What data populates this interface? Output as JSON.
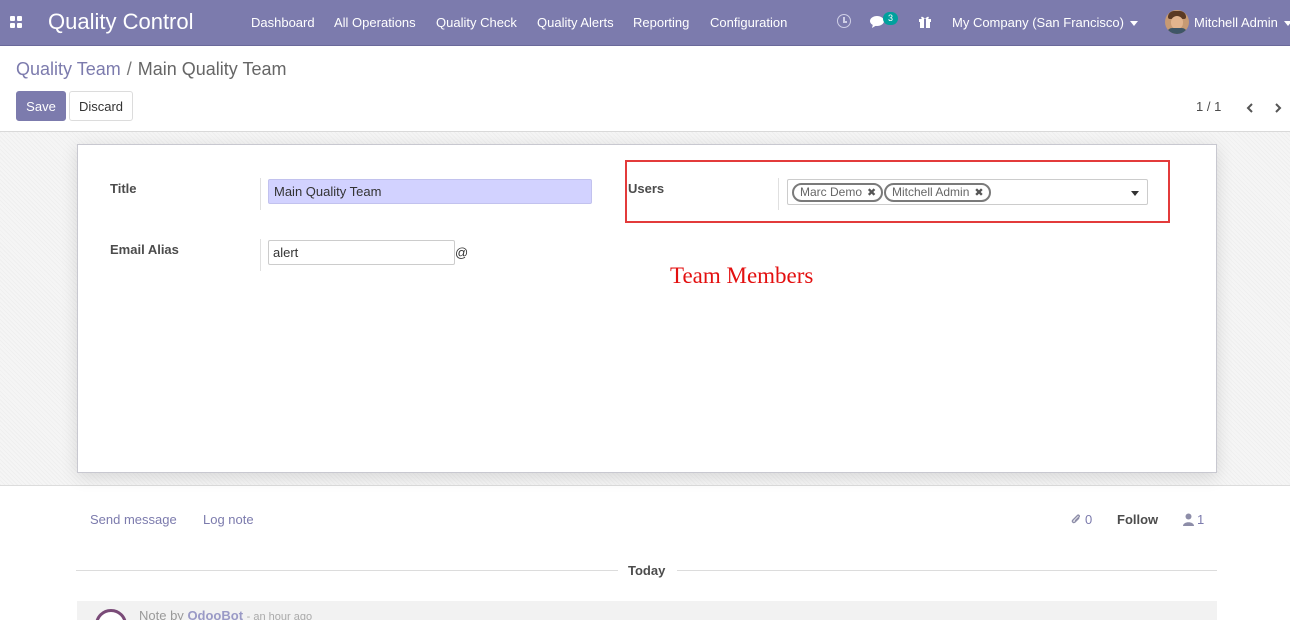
{
  "colors": {
    "brand": "#7c7bad",
    "accent": "#00a09d",
    "annotation": "#e31010",
    "title_field_bg": "#d2d2ff"
  },
  "navbar": {
    "apps_icon": "apps-grid-icon",
    "app_title": "Quality Control",
    "menu": [
      {
        "label": "Dashboard"
      },
      {
        "label": "All Operations"
      },
      {
        "label": "Quality Check"
      },
      {
        "label": "Quality Alerts"
      },
      {
        "label": "Reporting"
      },
      {
        "label": "Configuration"
      }
    ],
    "activity_icon": "clock-icon",
    "messages_icon": "chat-icon",
    "messages_count": "3",
    "gift_icon": "gift-icon",
    "company": "My Company (San Francisco)",
    "user": "Mitchell Admin"
  },
  "breadcrumb": {
    "parent": "Quality Team",
    "separator": "/",
    "current": "Main Quality Team"
  },
  "actions": {
    "save": "Save",
    "discard": "Discard"
  },
  "pager": {
    "value": "1 / 1"
  },
  "form": {
    "title_label": "Title",
    "title_value": "Main Quality Team",
    "email_alias_label": "Email Alias",
    "email_alias_value": "alert",
    "email_alias_suffix": "@",
    "users_label": "Users",
    "users": [
      "Marc Demo",
      "Mitchell Admin"
    ],
    "annotation": "Team Members"
  },
  "chatter": {
    "send_message": "Send message",
    "log_note": "Log note",
    "attachments_count": "0",
    "follow": "Follow",
    "followers_count": "1",
    "today": "Today",
    "message": {
      "prefix": "Note by",
      "author": "OdooBot",
      "time": "- an hour ago"
    }
  }
}
